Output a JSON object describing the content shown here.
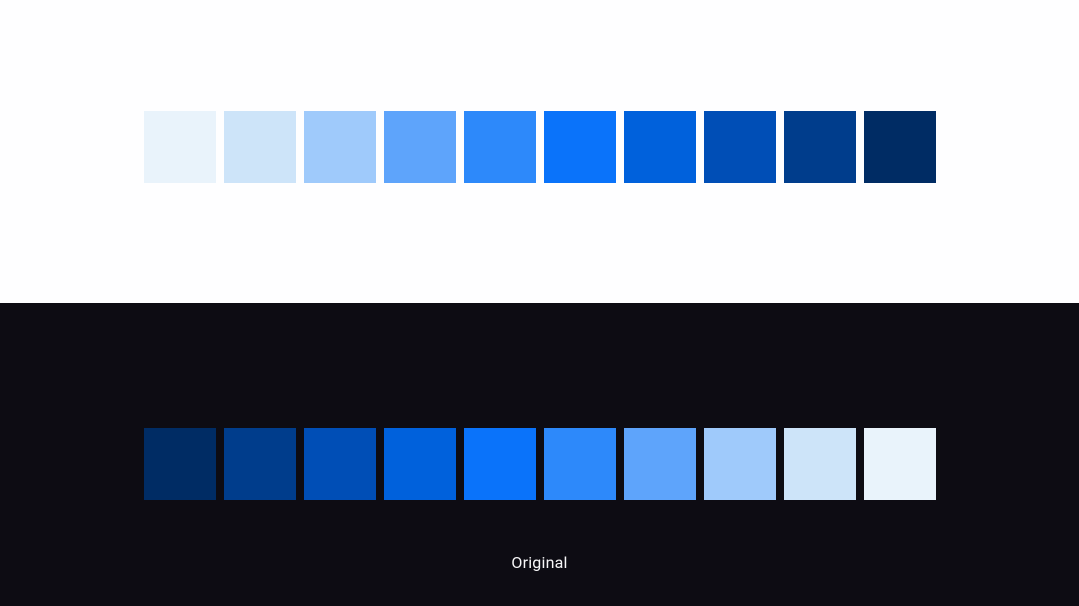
{
  "light": {
    "swatches": [
      "#e9f3fb",
      "#cde4f9",
      "#9fcafb",
      "#5ea4fb",
      "#2d89fa",
      "#0a73fa",
      "#0061dc",
      "#004eb6",
      "#003d8c",
      "#002c64"
    ]
  },
  "dark": {
    "swatches": [
      "#002c64",
      "#003d8c",
      "#004eb6",
      "#0061dc",
      "#0a73fa",
      "#2d89fa",
      "#5ea4fb",
      "#9fcafb",
      "#cde4f9",
      "#e9f3fb"
    ],
    "caption": "Original"
  }
}
